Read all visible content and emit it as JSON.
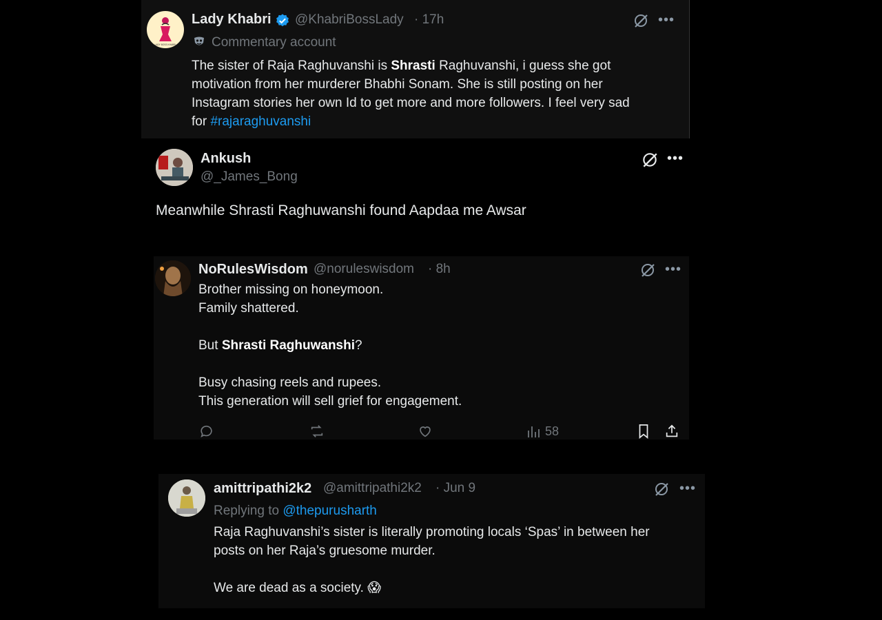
{
  "tweets": [
    {
      "name": "Lady Khabri",
      "handle": "@KhabriBossLady",
      "time": "· 17h",
      "label_icon": "commentary-mask-icon",
      "label": "Commentary account",
      "text_parts": [
        "The sister of Raja Raghuvanshi is ",
        "Shrasti",
        " Raghuvanshi, i guess she got\nmotivation from her murderer Bhabhi Sonam. She is still posting on her\nInstagram stories her own Id to get more and more followers.  I feel very sad\nfor ",
        "#rajaraghuvanshi"
      ],
      "avatar_caption": "LADY BOSS KHABRI"
    },
    {
      "name": "Ankush",
      "handle": "@_James_Bong",
      "text": "Meanwhile Shrasti Raghuwanshi found Aapdaa me Awsar"
    },
    {
      "name": "NoRulesWisdom",
      "handle": "@noruleswisdom",
      "time": "· 8h",
      "text_parts": [
        "Brother missing on honeymoon.\nFamily shattered.\n\nBut ",
        "Shrasti Raghuwanshi",
        "?\n\nBusy chasing reels and rupees.\nThis generation will sell grief for engagement."
      ],
      "views": "58"
    },
    {
      "name": "amittripathi2k2",
      "handle": "@amittripathi2k2",
      "time": "· Jun 9",
      "replying_prefix": "Replying to ",
      "replying_to": "@thepurusharth",
      "text": "Raja Raghuvanshi’s sister is literally promoting locals ‘Spas’ in between her\nposts on her Raja’s gruesome murder.\n\nWe are dead as a society. 😱"
    }
  ],
  "colors": {
    "accent": "#1d9bf0",
    "verified": "#1d9bf0",
    "muted": "#71767b"
  }
}
